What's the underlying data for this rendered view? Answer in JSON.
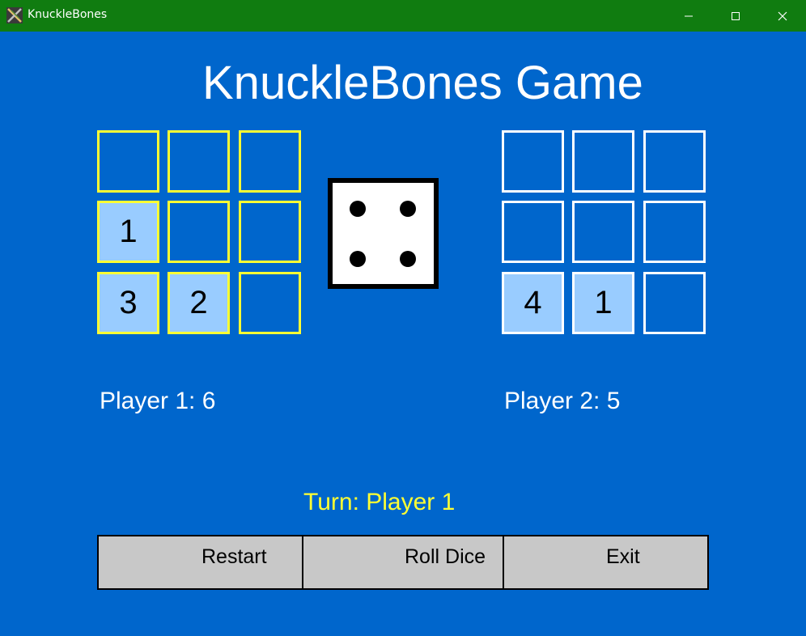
{
  "window": {
    "title": "KnuckleBones",
    "title_bar_color": "#107c10",
    "controls": [
      "minimize-icon",
      "maximize-icon",
      "close-icon"
    ]
  },
  "game": {
    "title": "KnuckleBones Game",
    "background_color": "#0066cc"
  },
  "player1": {
    "board_border_color": "#ffff33",
    "grid": [
      [
        "",
        "",
        ""
      ],
      [
        "1",
        "",
        ""
      ],
      [
        "3",
        "2",
        ""
      ]
    ],
    "score_label": "Player 1: 6"
  },
  "player2": {
    "board_border_color": "#ffffff",
    "grid": [
      [
        "",
        "",
        ""
      ],
      [
        "",
        "",
        ""
      ],
      [
        "4",
        "1",
        ""
      ]
    ],
    "score_label": "Player 2: 5"
  },
  "dice": {
    "value": 4
  },
  "turn_label": "Turn: Player 1",
  "buttons": {
    "restart": "Restart",
    "roll": "Roll Dice",
    "exit": "Exit"
  }
}
